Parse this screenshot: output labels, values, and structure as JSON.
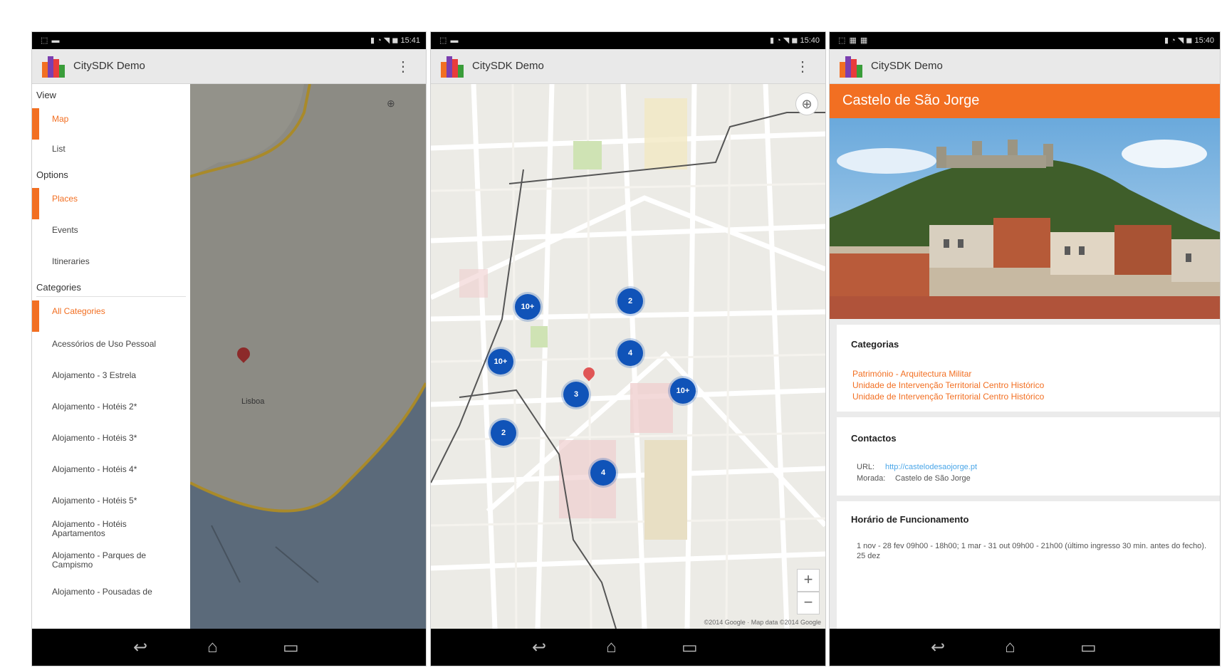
{
  "colors": {
    "accent": "#f26f22",
    "cluster": "#1053b8",
    "link": "#4aa6e8"
  },
  "phone1": {
    "status": {
      "left": "⬚ ▬",
      "right": "▮ ◔ ◥ ◼ 15:41"
    },
    "app_title": "CitySDK Demo",
    "drawer": {
      "view_header": "View",
      "view_items": [
        "Map",
        "List"
      ],
      "options_header": "Options",
      "options_items": [
        "Places",
        "Events",
        "Itineraries"
      ],
      "categories_header": "Categories",
      "category_items": [
        "All Categories",
        "Acessórios de Uso Pessoal",
        "Alojamento - 3 Estrela",
        "Alojamento - Hotéis 2*",
        "Alojamento - Hotéis 3*",
        "Alojamento - Hotéis 4*",
        "Alojamento - Hotéis 5*",
        "Alojamento - Hotéis Apartamentos",
        "Alojamento - Parques de Campismo",
        "Alojamento - Pousadas de"
      ]
    },
    "map_label": "Lisboa"
  },
  "phone2": {
    "status": {
      "left": "⬚ ▬",
      "right": "▮ ◔ ◥ ◼ 15:40"
    },
    "app_title": "CitySDK Demo",
    "clusters": [
      "10+",
      "2",
      "10+",
      "4",
      "3",
      "10+",
      "2",
      "4"
    ],
    "zoom_in": "+",
    "zoom_out": "−",
    "locate_icon": "⊕",
    "attribution": "©2014 Google · Map data ©2014 Google"
  },
  "phone3": {
    "status": {
      "left": "⬚ ▦ ▦",
      "right": "▮ ◔ ◥ ◼ 15:40"
    },
    "app_title": "CitySDK Demo",
    "poi_title": "Castelo de São Jorge",
    "categories_title": "Categorias",
    "categories": [
      "Património - Arquitectura Militar",
      "Unidade de Intervenção Territorial Centro Histórico",
      "Unidade de Intervenção Territorial Centro Histórico"
    ],
    "contacts_title": "Contactos",
    "url_label": "URL:",
    "url_value": "http://castelodesaojorge.pt",
    "address_label": "Morada:",
    "address_value": "Castelo de São Jorge",
    "hours_title": "Horário de Funcionamento",
    "hours_text": "1 nov - 28 fev 09h00 - 18h00; 1 mar - 31 out 09h00 - 21h00 (último ingresso 30 min. antes do fecho). 25 dez"
  },
  "navbar": {
    "back_icon": "↩",
    "home_icon": "⌂",
    "recents_icon": "▭"
  }
}
